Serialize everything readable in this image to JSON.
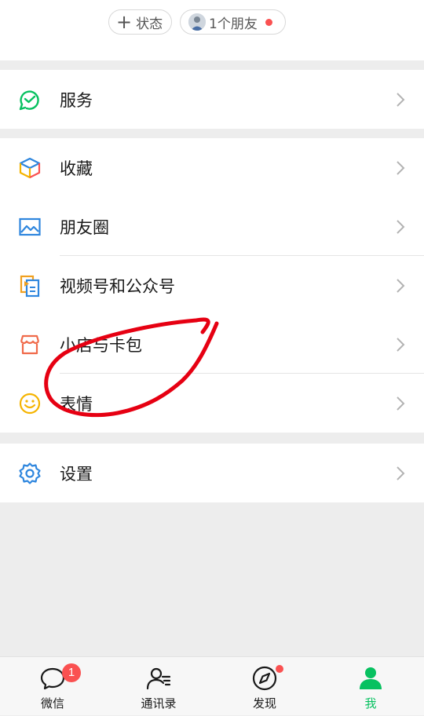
{
  "top": {
    "status_label": "状态",
    "friends_label": "1个朋友"
  },
  "menu": {
    "services": "服务",
    "favorites": "收藏",
    "moments": "朋友圈",
    "channels": "视频号和公众号",
    "shop_cards": "小店与卡包",
    "stickers": "表情",
    "settings": "设置"
  },
  "tabbar": {
    "chats": "微信",
    "chats_badge": "1",
    "contacts": "通讯录",
    "discover": "发现",
    "me": "我"
  },
  "colors": {
    "accent_green": "#07c160",
    "badge_red": "#fa5151",
    "annotation_red": "#e60012"
  }
}
